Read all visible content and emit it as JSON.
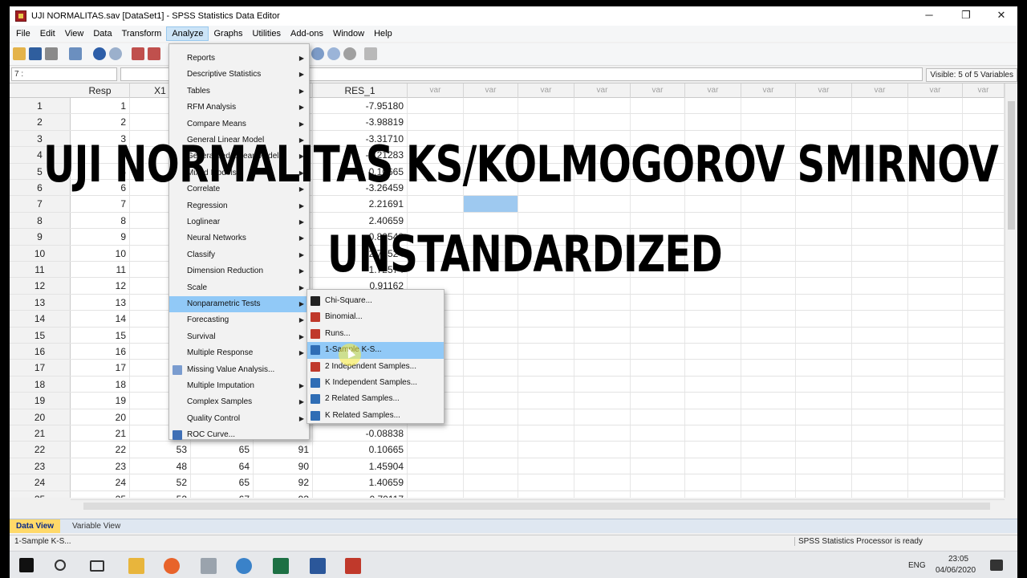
{
  "window": {
    "title": "UJI NORMALITAS.sav [DataSet1] - SPSS Statistics Data Editor",
    "minimize": "─",
    "restore": "❐",
    "close": "✕"
  },
  "menubar": [
    "File",
    "Edit",
    "View",
    "Data",
    "Transform",
    "Analyze",
    "Graphs",
    "Utilities",
    "Add-ons",
    "Window",
    "Help"
  ],
  "active_menu": "Analyze",
  "cell_editor": {
    "ref": "7 :",
    "value": ""
  },
  "visible_label": "Visible: 5 of 5 Variables",
  "grid": {
    "columns": [
      "Resp",
      "X1",
      "",
      "",
      "RES_1",
      "var",
      "var",
      "var",
      "var",
      "var",
      "var",
      "var",
      "var",
      "var",
      "var",
      "var"
    ],
    "rows": [
      {
        "n": "1",
        "resp": "1",
        "res": "-7.95180"
      },
      {
        "n": "2",
        "resp": "2",
        "res": "-3.98819"
      },
      {
        "n": "3",
        "resp": "3",
        "res": "-3.31710"
      },
      {
        "n": "4",
        "resp": "4",
        "res": "-4.21283"
      },
      {
        "n": "5",
        "resp": "5",
        "res": "0.10665"
      },
      {
        "n": "6",
        "resp": "6",
        "res": "-3.26459"
      },
      {
        "n": "7",
        "resp": "7",
        "res": "2.21691"
      },
      {
        "n": "8",
        "resp": "8",
        "res": "2.40659"
      },
      {
        "n": "9",
        "resp": "9",
        "res": "-0.80548"
      },
      {
        "n": "10",
        "resp": "10",
        "res": "2.70524"
      },
      {
        "n": "11",
        "resp": "11",
        "res": "1.72574"
      },
      {
        "n": "12",
        "resp": "12",
        "res": "0.91162"
      },
      {
        "n": "13",
        "resp": "13",
        "res": ""
      },
      {
        "n": "14",
        "resp": "14",
        "res": ""
      },
      {
        "n": "15",
        "resp": "15",
        "res": ""
      },
      {
        "n": "16",
        "resp": "16",
        "res": ""
      },
      {
        "n": "17",
        "resp": "17",
        "res": ""
      },
      {
        "n": "18",
        "resp": "18",
        "res": ""
      },
      {
        "n": "19",
        "resp": "19",
        "res": ""
      },
      {
        "n": "20",
        "resp": "20",
        "res": ""
      },
      {
        "n": "21",
        "resp": "21",
        "res": "-0.08838"
      },
      {
        "n": "22",
        "resp": "22",
        "x1": "53",
        "c3": "65",
        "c4": "91",
        "res": "0.10665"
      },
      {
        "n": "23",
        "resp": "23",
        "x1": "48",
        "c3": "64",
        "c4": "90",
        "res": "1.45904"
      },
      {
        "n": "24",
        "resp": "24",
        "x1": "52",
        "c3": "65",
        "c4": "92",
        "res": "1.40659"
      },
      {
        "n": "25",
        "resp": "25",
        "x1": "52",
        "c3": "67",
        "c4": "93",
        "res": "0.70117"
      }
    ]
  },
  "analyze_menu": [
    {
      "label": "Reports",
      "sub": true
    },
    {
      "label": "Descriptive Statistics",
      "sub": true
    },
    {
      "label": "Tables",
      "sub": true
    },
    {
      "label": "RFM Analysis",
      "sub": true
    },
    {
      "label": "Compare Means",
      "sub": true
    },
    {
      "label": "General Linear Model",
      "sub": true
    },
    {
      "label": "Generalized Linear Models",
      "sub": true
    },
    {
      "label": "Mixed Models",
      "sub": true
    },
    {
      "label": "Correlate",
      "sub": true
    },
    {
      "label": "Regression",
      "sub": true
    },
    {
      "label": "Loglinear",
      "sub": true
    },
    {
      "label": "Neural Networks",
      "sub": true
    },
    {
      "label": "Classify",
      "sub": true
    },
    {
      "label": "Dimension Reduction",
      "sub": true
    },
    {
      "label": "Scale",
      "sub": true
    },
    {
      "label": "Nonparametric Tests",
      "sub": true,
      "highlight": true
    },
    {
      "label": "Forecasting",
      "sub": true
    },
    {
      "label": "Survival",
      "sub": true
    },
    {
      "label": "Multiple Response",
      "sub": true
    },
    {
      "label": "Missing Value Analysis...",
      "sub": false,
      "icon": "missing-value-icon"
    },
    {
      "label": "Multiple Imputation",
      "sub": true
    },
    {
      "label": "Complex Samples",
      "sub": true
    },
    {
      "label": "Quality Control",
      "sub": true
    },
    {
      "label": "ROC Curve...",
      "sub": false,
      "icon": "roc-curve-icon"
    }
  ],
  "nonparametric_menu": [
    {
      "label": "Chi-Square...",
      "icon": "chi-square-icon"
    },
    {
      "label": "Binomial...",
      "icon": "binomial-icon"
    },
    {
      "label": "Runs...",
      "icon": "runs-icon"
    },
    {
      "label": "1-Sample K-S...",
      "icon": "ks-icon",
      "highlight": true
    },
    {
      "label": "2 Independent Samples...",
      "icon": "two-independent-icon"
    },
    {
      "label": "K Independent Samples...",
      "icon": "k-independent-icon"
    },
    {
      "label": "2 Related Samples...",
      "icon": "two-related-icon"
    },
    {
      "label": "K Related Samples...",
      "icon": "k-related-icon"
    }
  ],
  "tabs": [
    "Data View",
    "Variable View"
  ],
  "status": {
    "left": "1-Sample K-S...",
    "right": "SPSS Statistics  Processor is ready"
  },
  "taskbar": {
    "lang": "ENG",
    "time": "23:05",
    "date": "04/06/2020"
  },
  "overlay": {
    "line1": "UJI NORMALITAS KS/KOLMOGOROV SMIRNOV",
    "line2": "UNSTANDARDIZED"
  },
  "colors": {
    "menu_highlight": "#91c9f7",
    "active_tab": "#ffd969",
    "selected_cell": "#9ec9f0"
  }
}
